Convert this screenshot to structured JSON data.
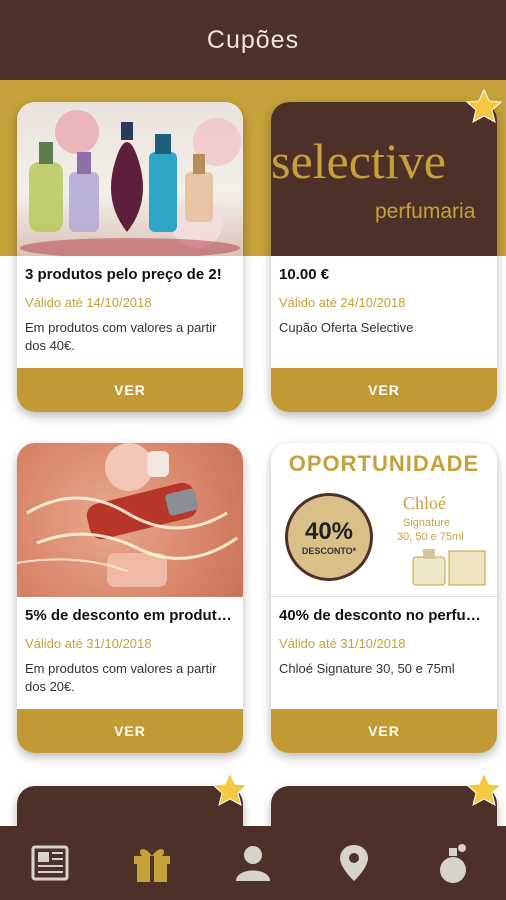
{
  "header": {
    "title": "Cupões"
  },
  "coupons": [
    {
      "title": "3 produtos pelo preço de 2!",
      "valid": "Válido até 14/10/2018",
      "description": "Em produtos com valores a partir dos 40€.",
      "button": "VER"
    },
    {
      "title": "10.00 €",
      "valid": "Válido até 24/10/2018",
      "description": "Cupão Oferta Selective",
      "button": "VER",
      "image_text": {
        "brand": "selective",
        "sub": "perfumaria"
      }
    },
    {
      "title": "5% de desconto em produt…",
      "valid": "Válido até 31/10/2018",
      "description": "Em produtos com valores a partir dos 20€.",
      "button": "VER"
    },
    {
      "title": "40% de desconto no perfu…",
      "valid": "Válido até 31/10/2018",
      "description": " Chloé Signature 30, 50 e 75ml",
      "button": "VER",
      "image_text": {
        "headline": "OPORTUNIDADE",
        "percent": "40%",
        "discount_label": "DESCONTO*",
        "product": "Chloé",
        "line": "Signature",
        "sizes": "30, 50 e 75ml"
      }
    }
  ],
  "bottom_nav": [
    {
      "icon": "newspaper-icon"
    },
    {
      "icon": "gift-icon",
      "active": true
    },
    {
      "icon": "user-icon"
    },
    {
      "icon": "location-pin-icon"
    },
    {
      "icon": "perfume-bottle-icon"
    }
  ],
  "colors": {
    "primary_brown": "#4d3128",
    "gold": "#c6a13a",
    "button_gold": "#c29a33",
    "inactive_icon": "#d8d2cc"
  }
}
